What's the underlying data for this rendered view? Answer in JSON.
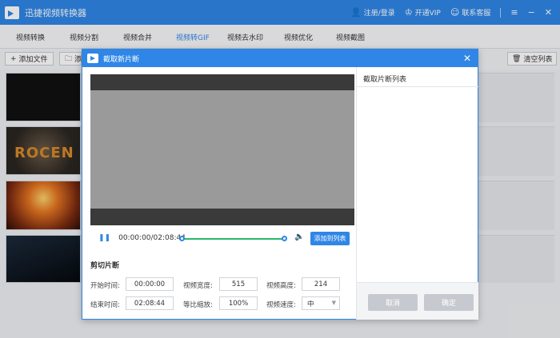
{
  "app": {
    "title": "迅捷视频转换器"
  },
  "titlebar": {
    "login": "注册/登录",
    "vip": "开通VIP",
    "support": "联系客服"
  },
  "nav": {
    "tabs": [
      "视频转换",
      "视频分割",
      "视频合并",
      "视频转GIF",
      "视频去水印",
      "视频优化",
      "视频截图"
    ],
    "active_index": 3
  },
  "toolbar": {
    "add_file": "添加文件",
    "add_folder_partial": "添",
    "clear_list": "清空列表"
  },
  "dialog": {
    "title": "截取新片断",
    "player": {
      "timecode": "00:00:00/02:08:44",
      "add_to_list": "添加到列表"
    },
    "clip": {
      "section_label": "剪切片断",
      "start_label": "开始时间:",
      "start_value": "00:00:00",
      "end_label": "结束时间:",
      "end_value": "02:08:44",
      "width_label": "视频宽度:",
      "width_value": "515",
      "height_label": "视频高度:",
      "height_value": "214",
      "scale_label": "等比缩放:",
      "scale_value": "100%",
      "speed_label": "视频速度:",
      "speed_value": "中"
    },
    "list_panel": {
      "title": "截取片断列表"
    },
    "buttons": {
      "cancel": "取消",
      "confirm": "确定"
    }
  },
  "colors": {
    "accent": "#2f86e6",
    "timeline": "#2ab76a"
  }
}
